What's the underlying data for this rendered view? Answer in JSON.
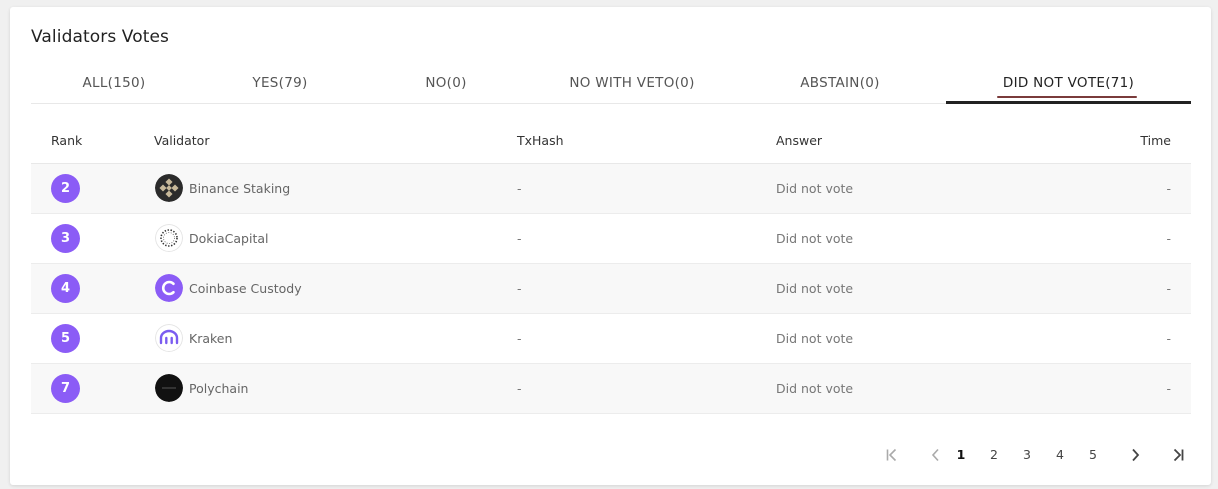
{
  "title": "Validators Votes",
  "tabs": [
    {
      "label": "ALL(150)"
    },
    {
      "label": "YES(79)"
    },
    {
      "label": "NO(0)"
    },
    {
      "label": "NO WITH VETO(0)"
    },
    {
      "label": "ABSTAIN(0)"
    },
    {
      "label": "DID NOT VOTE(71)"
    }
  ],
  "table": {
    "headers": {
      "rank": "Rank",
      "validator": "Validator",
      "txhash": "TxHash",
      "answer": "Answer",
      "time": "Time"
    },
    "rows": [
      {
        "rank": "2",
        "validator": "Binance Staking",
        "logo": "binance-logo-icon",
        "txhash": "-",
        "answer": "Did not vote",
        "time": "-"
      },
      {
        "rank": "3",
        "validator": "DokiaCapital",
        "logo": "dokia-logo-icon",
        "txhash": "-",
        "answer": "Did not vote",
        "time": "-"
      },
      {
        "rank": "4",
        "validator": "Coinbase Custody",
        "logo": "coinbase-logo-icon",
        "txhash": "-",
        "answer": "Did not vote",
        "time": "-"
      },
      {
        "rank": "5",
        "validator": "Kraken",
        "logo": "kraken-logo-icon",
        "txhash": "-",
        "answer": "Did not vote",
        "time": "-"
      },
      {
        "rank": "7",
        "validator": "Polychain",
        "logo": "polychain-logo-icon",
        "txhash": "-",
        "answer": "Did not vote",
        "time": "-"
      }
    ]
  },
  "pagination": {
    "pages": [
      "1",
      "2",
      "3",
      "4",
      "5"
    ],
    "current": "1"
  },
  "colors": {
    "rank_badge": "#8b5cf6",
    "active_tab_bar": "#222222",
    "active_tab_text_underline": "#7a3b3b"
  }
}
